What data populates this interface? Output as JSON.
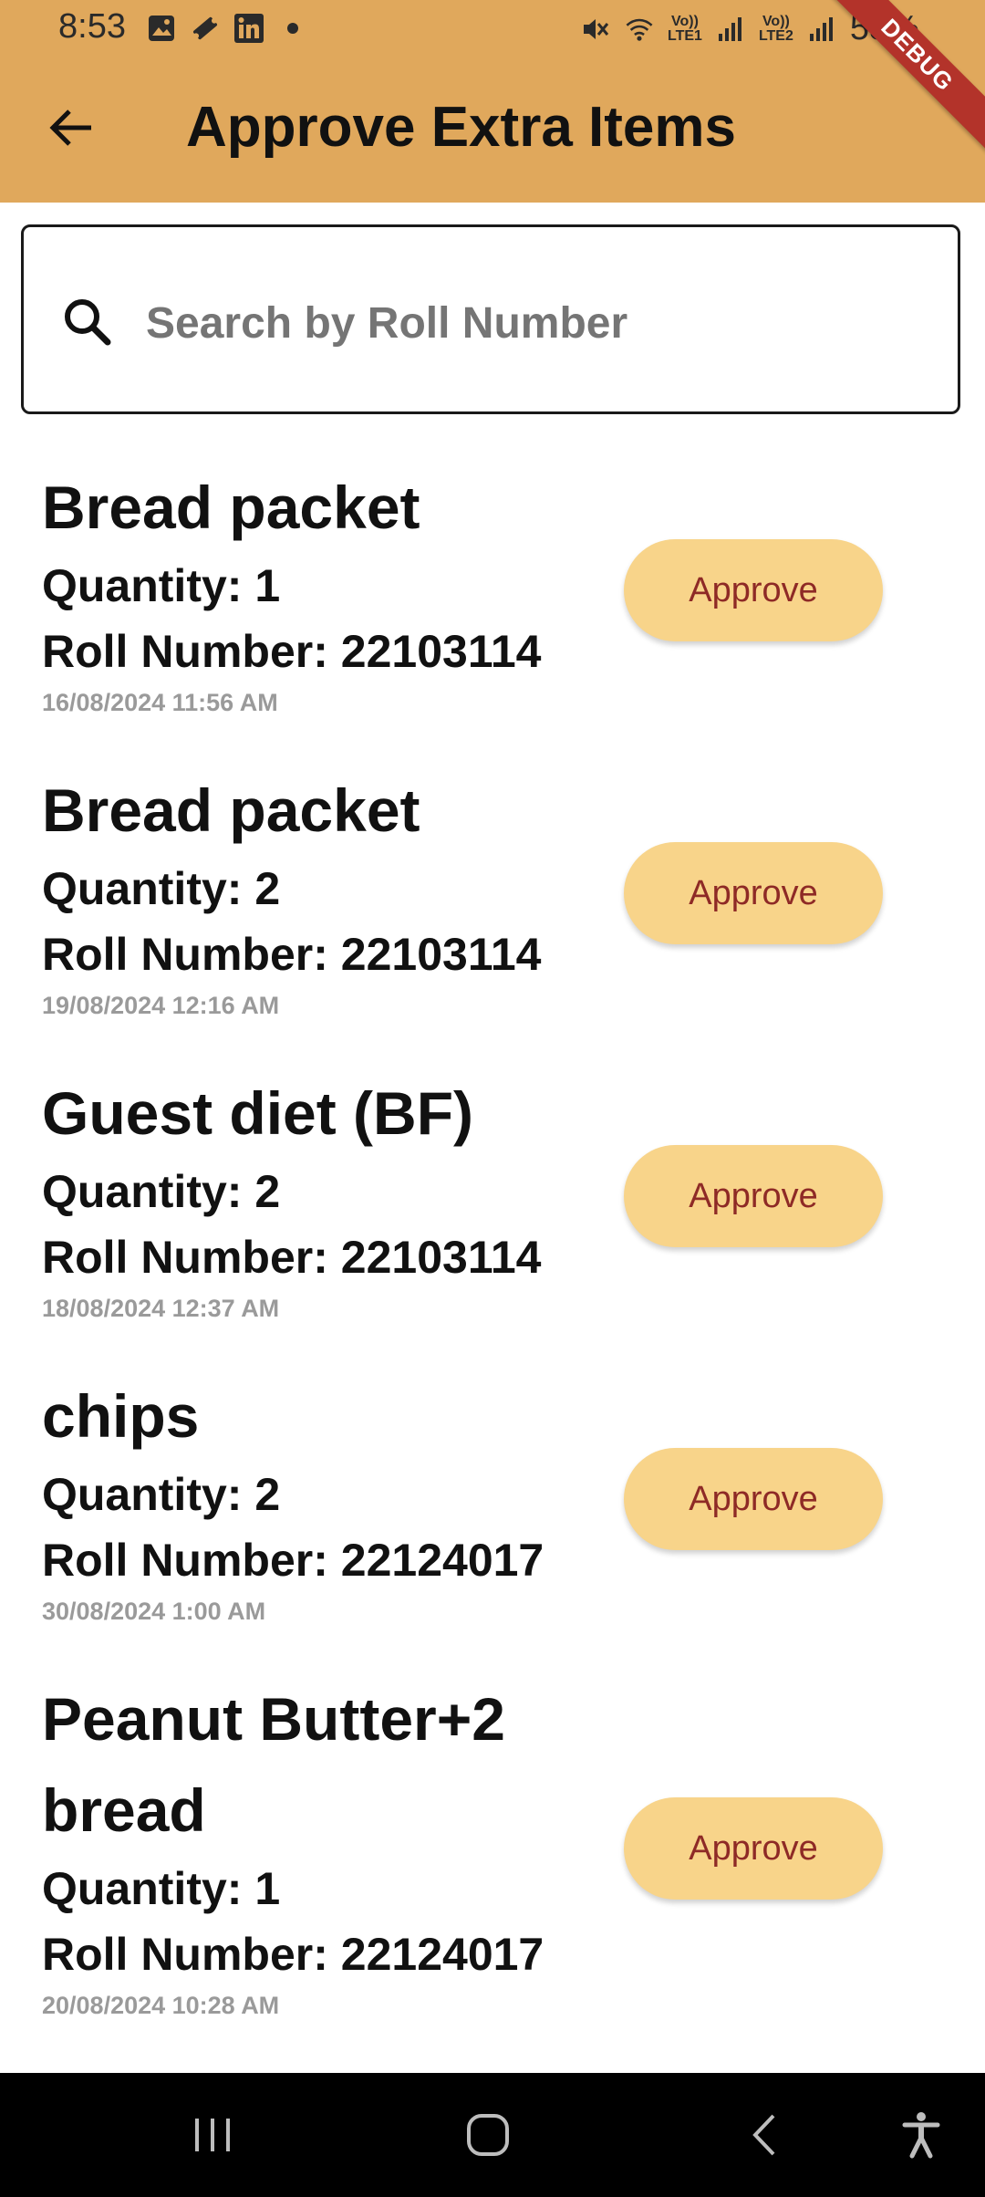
{
  "status_bar": {
    "time": "8:53",
    "left_icons": [
      "gallery-icon",
      "ticket-icon",
      "linkedin-icon",
      "dot-icon"
    ],
    "sim1_label": "Vo))\nLTE1",
    "sim2_label": "Vo))\nLTE2",
    "battery": "55%"
  },
  "app_bar": {
    "title": "Approve Extra Items",
    "back_icon": "arrow-back-icon",
    "debug_banner": "DEBUG"
  },
  "search": {
    "placeholder": "Search by Roll Number"
  },
  "items": [
    {
      "name": "Bread packet",
      "quantity": "Quantity: 1",
      "roll": "Roll Number: 22103114",
      "date": "16/08/2024 11:56 AM",
      "button": "Approve"
    },
    {
      "name": "Bread packet",
      "quantity": "Quantity: 2",
      "roll": "Roll Number: 22103114",
      "date": "19/08/2024 12:16 AM",
      "button": "Approve"
    },
    {
      "name": "Guest diet (BF)",
      "quantity": "Quantity: 2",
      "roll": "Roll Number: 22103114",
      "date": "18/08/2024 12:37 AM",
      "button": "Approve"
    },
    {
      "name": "chips",
      "quantity": "Quantity: 2",
      "roll": "Roll Number: 22124017",
      "date": "30/08/2024 1:00 AM",
      "button": "Approve"
    },
    {
      "name": "Peanut Butter+2 bread",
      "quantity": "Quantity: 1",
      "roll": "Roll Number: 22124017",
      "date": "20/08/2024 10:28 AM",
      "button": "Approve"
    }
  ],
  "nav_bar": {
    "icons": [
      "recents-icon",
      "home-icon",
      "back-icon",
      "accessibility-icon"
    ]
  },
  "colors": {
    "header": "#e0a85c",
    "button_bg": "#f8d48a",
    "button_text": "#8e2a26",
    "debug_ribbon": "#b3332a"
  }
}
